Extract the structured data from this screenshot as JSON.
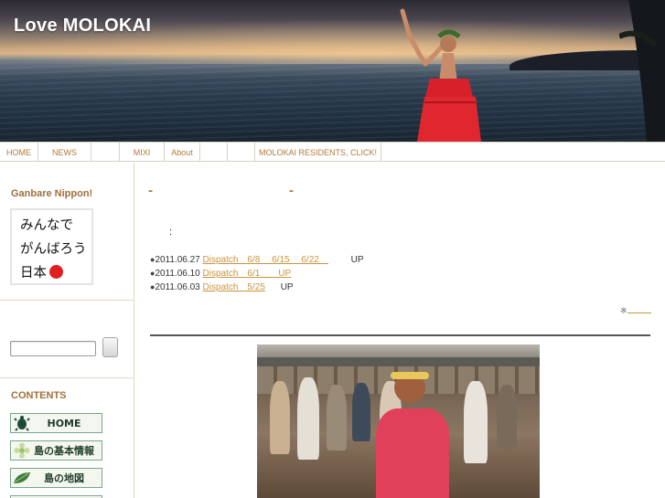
{
  "site": {
    "title": "Love MOLOKAI"
  },
  "nav": {
    "items": [
      {
        "label": "HOME",
        "width": 42
      },
      {
        "label": "NEWS",
        "width": 58
      },
      {
        "label": "",
        "width": 31
      },
      {
        "label": "MIXI",
        "width": 49
      },
      {
        "label": "About",
        "width": 39
      },
      {
        "label": "",
        "width": 30
      },
      {
        "label": "",
        "width": 30
      },
      {
        "label": "MOLOKAI RESIDENTS, CLICK!",
        "width": 138
      }
    ]
  },
  "sidebar": {
    "ganbare_heading": "Ganbare Nippon!",
    "nippon_lines": [
      "みんなで",
      "がんばろう",
      "日本"
    ],
    "contents_heading": "CONTENTS",
    "menu": [
      {
        "label": "HOME",
        "icon": "turtle-icon"
      },
      {
        "label": "島の基本情報",
        "icon": "flower-icon"
      },
      {
        "label": "島の地図",
        "icon": "leaf-icon"
      }
    ]
  },
  "main": {
    "title_dash_left": "-",
    "title_dash_right": "-",
    "colon": ":",
    "news": [
      {
        "date": "2011.06.27",
        "link": "Dispatch　6/8　 6/15　 6/22　",
        "suffix": "UP"
      },
      {
        "date": "2011.06.10",
        "link": "Dispatch　6/1　　UP",
        "suffix": ""
      },
      {
        "date": "2011.06.03",
        "link": "Dispatch　5/25",
        "suffix": "UP"
      }
    ],
    "note": "※",
    "bullet": "●"
  },
  "colors": {
    "accent": "#b07a3a",
    "link": "#c9943e",
    "border": "#d8d2c6",
    "menu_border": "#7aa58a"
  }
}
